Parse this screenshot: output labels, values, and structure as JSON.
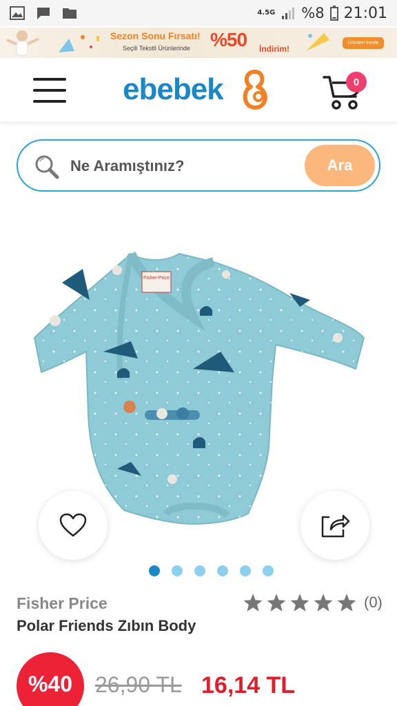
{
  "status_bar": {
    "network": "4.5G",
    "battery": "%8",
    "time": "21:01",
    "icons": [
      "image-icon",
      "chat-icon",
      "folder-icon",
      "signal-icon",
      "battery-icon"
    ]
  },
  "promo_banner": {
    "title": "Sezon Sonu Fırsatı!",
    "subtitle": "Seçili Tekstil Ürünlerinde",
    "percent": "%50",
    "discount_word": "İndirim!",
    "button_label": "Ürünleri İncele"
  },
  "header": {
    "logo_text": "ebebek",
    "cart_count": "0"
  },
  "search": {
    "placeholder": "Ne Aramıştınız?",
    "button_label": "Ara"
  },
  "product": {
    "image_tag": "Fisher-Price",
    "brand": "Fisher Price",
    "name": "Polar Friends Zıbın Body",
    "rating": 0,
    "rating_max": 5,
    "review_count": "(0)",
    "discount": "%40",
    "old_price": "26,90 TL",
    "new_price": "16,14 TL",
    "gallery_total": 6,
    "gallery_active": 1
  },
  "colors": {
    "brand_blue": "#1a87c7",
    "brand_orange": "#f08124",
    "search_button": "#fbb77c",
    "discount_red": "#ee2237",
    "price_red": "#e01e2a",
    "cart_badge": "#ee3e6d"
  }
}
